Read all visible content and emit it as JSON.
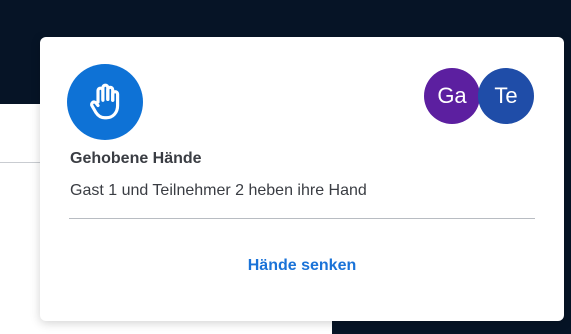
{
  "notification": {
    "icon": "raised-hand-icon",
    "title": "Gehobene Hände",
    "message": "Gast 1 und Teilnehmer 2 heben ihre Hand",
    "avatars": [
      {
        "initials": "Ga",
        "color": "#5c1fa0"
      },
      {
        "initials": "Te",
        "color": "#1f4da8"
      }
    ],
    "action_label": "Hände senken"
  },
  "colors": {
    "accent": "#0e72d6",
    "link": "#1a73d8",
    "background_dark": "#061426"
  }
}
